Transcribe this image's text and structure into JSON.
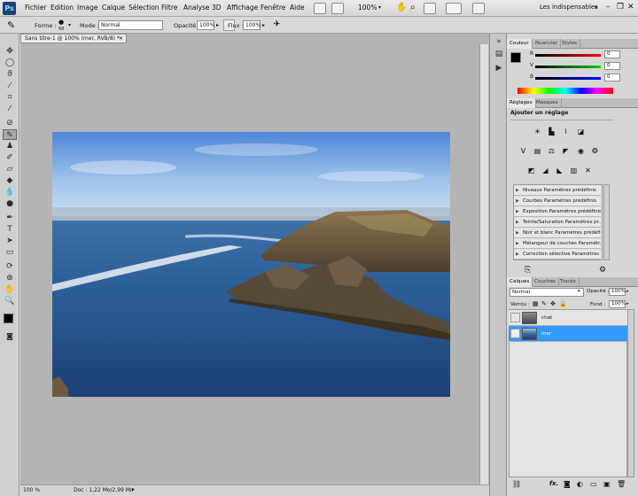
{
  "menubar": {
    "logo": "Ps",
    "items": [
      "Fichier",
      "Edition",
      "Image",
      "Calque",
      "Sélection",
      "Filtre",
      "Analyse",
      "3D",
      "Affichage",
      "Fenêtre",
      "Aide"
    ],
    "zoom": "100%",
    "workspace": "Les indispensables"
  },
  "options": {
    "forme_label": "Forme :",
    "brush_size": "68",
    "mode_label": "Mode :",
    "mode_value": "Normal",
    "opacity_label": "Opacité :",
    "opacity_value": "100%",
    "flux_label": "Flux :",
    "flux_value": "100%"
  },
  "document": {
    "tab_title": "Sans titre-1 @ 100% (mer, RVB/8) *",
    "status_zoom": "100 %",
    "status_doc": "Doc : 1,22 Mo/2,99 Mo"
  },
  "color_panel": {
    "tabs": [
      "Couleur",
      "Nuancier",
      "Styles"
    ],
    "channels": [
      {
        "label": "R",
        "value": "0"
      },
      {
        "label": "V",
        "value": "0"
      },
      {
        "label": "B",
        "value": "0"
      }
    ]
  },
  "adjust_panel": {
    "tabs": [
      "Réglages",
      "Masques"
    ],
    "title": "Ajouter un réglage",
    "presets": [
      "Niveaux Paramètres prédéfinis",
      "Courbes Paramètres prédéfinis",
      "Exposition Paramètres prédéfinis",
      "Teinte/Saturation Paramètres pr...",
      "Noir et blanc Paramètres prédéfinis",
      "Mélangeur de couches Paramètr...",
      "Correction sélective Paramètres ..."
    ]
  },
  "layers_panel": {
    "tabs": [
      "Calques",
      "Couches",
      "Tracés"
    ],
    "blend_mode": "Normal",
    "opacity_label": "Opacité :",
    "opacity_value": "100%",
    "lock_label": "Verrou :",
    "fill_label": "Fond :",
    "fill_value": "100%",
    "layers": [
      {
        "name": "chat",
        "visible": false,
        "selected": false
      },
      {
        "name": "mer",
        "visible": true,
        "selected": true
      }
    ]
  },
  "colors": {
    "selection": "#3399ff",
    "foreground": "#000000",
    "background": "#ffffff"
  }
}
